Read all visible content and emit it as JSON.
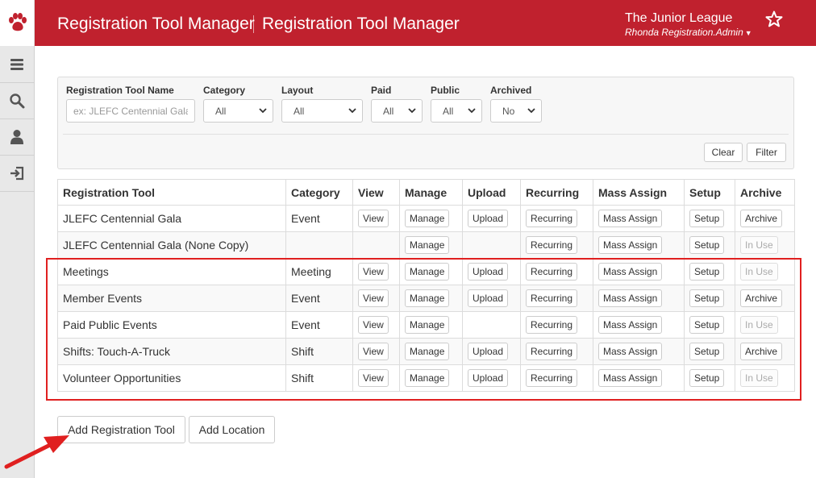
{
  "header": {
    "app_title": "Registration Tool Manager",
    "page_title": "Registration Tool Manager",
    "org_name": "The Junior League",
    "user_name": "Rhonda Registration.Admin",
    "brand_color": "#c0212e"
  },
  "sidebar": {
    "icons": [
      "menu-icon",
      "search-icon",
      "user-icon",
      "logout-icon"
    ]
  },
  "filters": {
    "name_label": "Registration Tool Name",
    "name_placeholder": "ex: JLEFC Centennial Gala",
    "category_label": "Category",
    "category_value": "All",
    "layout_label": "Layout",
    "layout_value": "All",
    "paid_label": "Paid",
    "paid_value": "All",
    "public_label": "Public",
    "public_value": "All",
    "archived_label": "Archived",
    "archived_value": "No",
    "clear_label": "Clear",
    "filter_label": "Filter"
  },
  "table": {
    "columns": [
      "Registration Tool",
      "Category",
      "View",
      "Manage",
      "Upload",
      "Recurring",
      "Mass Assign",
      "Setup",
      "Archive"
    ],
    "rows": [
      {
        "name": "JLEFC Centennial Gala",
        "category": "Event",
        "view": "View",
        "manage": "Manage",
        "upload": "Upload",
        "recurring": "Recurring",
        "mass_assign": "Mass Assign",
        "setup": "Setup",
        "archive": "Archive"
      },
      {
        "name": "JLEFC Centennial Gala (None Copy)",
        "category": "",
        "view": "",
        "manage": "Manage",
        "upload": "",
        "recurring": "Recurring",
        "mass_assign": "Mass Assign",
        "setup": "Setup",
        "archive": "In Use"
      },
      {
        "name": "Meetings",
        "category": "Meeting",
        "view": "View",
        "manage": "Manage",
        "upload": "Upload",
        "recurring": "Recurring",
        "mass_assign": "Mass Assign",
        "setup": "Setup",
        "archive": "In Use"
      },
      {
        "name": "Member Events",
        "category": "Event",
        "view": "View",
        "manage": "Manage",
        "upload": "Upload",
        "recurring": "Recurring",
        "mass_assign": "Mass Assign",
        "setup": "Setup",
        "archive": "Archive"
      },
      {
        "name": "Paid Public Events",
        "category": "Event",
        "view": "View",
        "manage": "Manage",
        "upload": "",
        "recurring": "Recurring",
        "mass_assign": "Mass Assign",
        "setup": "Setup",
        "archive": "In Use"
      },
      {
        "name": "Shifts: Touch-A-Truck",
        "category": "Shift",
        "view": "View",
        "manage": "Manage",
        "upload": "Upload",
        "recurring": "Recurring",
        "mass_assign": "Mass Assign",
        "setup": "Setup",
        "archive": "Archive"
      },
      {
        "name": "Volunteer Opportunities",
        "category": "Shift",
        "view": "View",
        "manage": "Manage",
        "upload": "Upload",
        "recurring": "Recurring",
        "mass_assign": "Mass Assign",
        "setup": "Setup",
        "archive": "In Use"
      }
    ]
  },
  "actions": {
    "add_tool_label": "Add Registration Tool",
    "add_location_label": "Add Location"
  },
  "annotation": {
    "color": "#e02020"
  }
}
